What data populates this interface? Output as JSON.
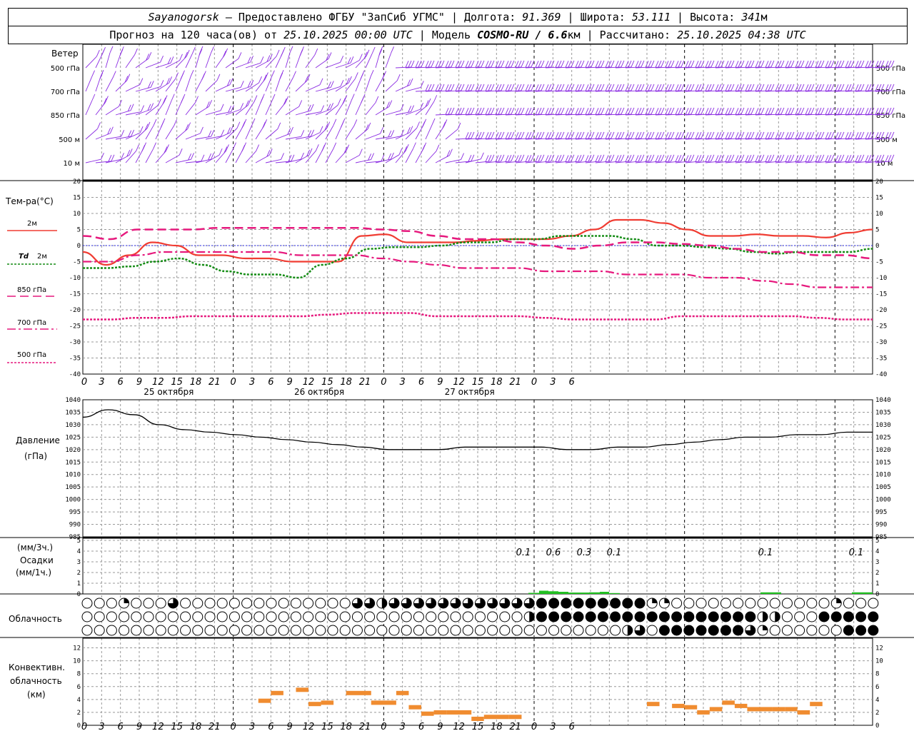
{
  "header": {
    "station": "Sayanogorsk",
    "provided": " — Предоставлено ФГБУ \"ЗапСиб УГМС\" | Долгота: ",
    "lon": "91.369",
    "lat_label": " | Широта: ",
    "lat": "53.111",
    "alt_label": " | Высота: ",
    "alt": "341",
    "alt_unit": "м",
    "forecast_label": "Прогноз на 120 часа(ов) от ",
    "forecast_from": "25.10.2025 00:00 UTC",
    "model_label": " | Модель ",
    "model": "COSMO-RU / 6.6",
    "model_unit": "км",
    "computed_label": " | Рассчитано: ",
    "computed": "25.10.2025 04:38 UTC"
  },
  "labels": {
    "wind": "Ветер",
    "wind_levels": [
      "500 гПа",
      "700 гПа",
      "850 гПа",
      "500 м",
      "10  м"
    ],
    "temp": "Тем-ра(°С)",
    "legend_2m": "2м",
    "legend_td_a": "Td",
    "legend_td_b": "2м",
    "legend_850": "850 гПа",
    "legend_700": "700 гПа",
    "legend_500": "500 гПа",
    "pressure": "Давление",
    "pressure_unit": "(гПа)",
    "precip_unit": "(мм/3ч.)",
    "precip": "Осадки",
    "precip_unit2": "(мм/1ч.)",
    "cloud": "Облачность",
    "conv1": "Конвективн.",
    "conv2": "облачность",
    "conv3": "(км)"
  },
  "colors": {
    "t2m": "#f03c32",
    "td2m": "#148c14",
    "t850": "#e6197d",
    "t700": "#e6197d",
    "t500": "#e6197d",
    "wind": "#8a2be2",
    "precip": "#22c022",
    "conv": "#f08c30",
    "zero": "#2a2ae0"
  },
  "chart_data": [
    {
      "type": "line",
      "name": "temperature",
      "x_hours": [
        0,
        3,
        6,
        9,
        12,
        15,
        18,
        21,
        24,
        27,
        30,
        33,
        36,
        39,
        42,
        45,
        48,
        51,
        54,
        57,
        60,
        63,
        66,
        69,
        72,
        75,
        78,
        81,
        84,
        87,
        90,
        93,
        96,
        99,
        102,
        105,
        108,
        111,
        114,
        117,
        120,
        123,
        126
      ],
      "x_ticks": [
        "0",
        "3",
        "6",
        "9",
        "12",
        "15",
        "18",
        "21",
        "0",
        "3",
        "6",
        "9",
        "12",
        "15",
        "18",
        "21",
        "0",
        "3",
        "6",
        "9",
        "12",
        "15",
        "18",
        "21",
        "0",
        "3",
        "6"
      ],
      "date_labels": [
        "25 октября",
        "26 октября",
        "27 октября"
      ],
      "ylim": [
        -40,
        20
      ],
      "yticks": [
        20,
        15,
        10,
        5,
        0,
        -5,
        -10,
        -15,
        -20,
        -25,
        -30,
        -35,
        -40
      ],
      "series": [
        {
          "name": "2м",
          "values": [
            -2,
            -6,
            -3,
            1,
            0,
            -3,
            -3,
            -4,
            -4,
            -5,
            -5,
            -5,
            3,
            3.5,
            1,
            1,
            1,
            1.5,
            2,
            2,
            2,
            3,
            5,
            8,
            8,
            7,
            5,
            3,
            3,
            3.5,
            3,
            3,
            2.5,
            4,
            5
          ]
        },
        {
          "name": "Td 2м",
          "values": [
            -7,
            -7,
            -6.5,
            -5,
            -4,
            -6,
            -8,
            -9,
            -9,
            -10,
            -6,
            -4,
            -1,
            -0.5,
            -0.5,
            0,
            1,
            1,
            2,
            2,
            3,
            3,
            3,
            2,
            0,
            0,
            -0.5,
            -1,
            -2,
            -2.5,
            -2,
            -2,
            -2,
            -1
          ]
        },
        {
          "name": "850 гПа",
          "values": [
            3,
            2,
            5,
            5,
            5,
            5.5,
            5.5,
            5.5,
            5.5,
            5.5,
            5.5,
            5,
            4.5,
            3,
            2,
            2,
            1,
            0,
            -1,
            0,
            1,
            1,
            0.5,
            0,
            -1,
            -2,
            -2,
            -3,
            -3,
            -4
          ]
        },
        {
          "name": "700 гПа",
          "values": [
            -5,
            -5,
            -3,
            -2,
            -2,
            -2,
            -2,
            -2,
            -3,
            -3,
            -3,
            -4,
            -5,
            -6,
            -7,
            -7,
            -7,
            -8,
            -8,
            -8,
            -9,
            -9,
            -9,
            -10,
            -10,
            -11,
            -12,
            -13,
            -13,
            -13
          ]
        },
        {
          "name": "500 гПа",
          "values": [
            -23,
            -23,
            -22.5,
            -22.5,
            -22,
            -22,
            -22,
            -22,
            -22,
            -21.5,
            -21,
            -21,
            -21,
            -22,
            -22,
            -22,
            -22,
            -22.5,
            -23,
            -23,
            -23,
            -23,
            -22,
            -22,
            -22,
            -22,
            -22,
            -22.5,
            -23,
            -23
          ]
        }
      ]
    },
    {
      "type": "line",
      "name": "pressure",
      "ylim": [
        985,
        1040
      ],
      "yticks": [
        1040,
        1035,
        1030,
        1025,
        1020,
        1015,
        1010,
        1005,
        1000,
        995,
        990,
        985
      ],
      "series": [
        {
          "name": "",
          "values": [
            1033,
            1036,
            1034,
            1030,
            1028,
            1027,
            1026,
            1025,
            1024,
            1023,
            1022,
            1021,
            1020,
            1020,
            1020,
            1021,
            1021,
            1021,
            1021,
            1020,
            1020,
            1021,
            1021,
            1022,
            1023,
            1024,
            1025,
            1025,
            1026,
            1026,
            1027,
            1027
          ]
        }
      ]
    },
    {
      "type": "bar",
      "name": "precipitation",
      "ylim": [
        0,
        5
      ],
      "yticks": [
        5,
        4,
        3,
        2,
        1,
        0
      ],
      "labels_3h": [
        "0.1",
        "0.6",
        "0.3",
        "0.1",
        "0.1",
        "0.1"
      ]
    },
    {
      "type": "bar",
      "name": "convective_cloud",
      "ylim": [
        0,
        13
      ],
      "yticks": [
        12,
        10,
        8,
        6,
        4,
        2,
        0
      ],
      "segments": [
        [
          14,
          15,
          3.8
        ],
        [
          15,
          16,
          5
        ],
        [
          17,
          18,
          5.5
        ],
        [
          18,
          19,
          3.3
        ],
        [
          19,
          20,
          3.5
        ],
        [
          21,
          23,
          5
        ],
        [
          23,
          25,
          3.5
        ],
        [
          25,
          26,
          5
        ],
        [
          26,
          27,
          2.8
        ],
        [
          27,
          28,
          1.8
        ],
        [
          28,
          29,
          2
        ],
        [
          29,
          31,
          2
        ],
        [
          31,
          32,
          1
        ],
        [
          32,
          34,
          1.3
        ],
        [
          34,
          35,
          1.3
        ],
        [
          45,
          46,
          3.3
        ],
        [
          47,
          48,
          3
        ],
        [
          48,
          49,
          2.8
        ],
        [
          49,
          50,
          2
        ],
        [
          50,
          51,
          2.5
        ],
        [
          51,
          52,
          3.5
        ],
        [
          52,
          53,
          3
        ],
        [
          53,
          54,
          2.5
        ],
        [
          54,
          55,
          2.5
        ],
        [
          55,
          56,
          2.5
        ],
        [
          56,
          57,
          2.5
        ],
        [
          57,
          58,
          2
        ],
        [
          58,
          59,
          3.3
        ]
      ]
    }
  ]
}
